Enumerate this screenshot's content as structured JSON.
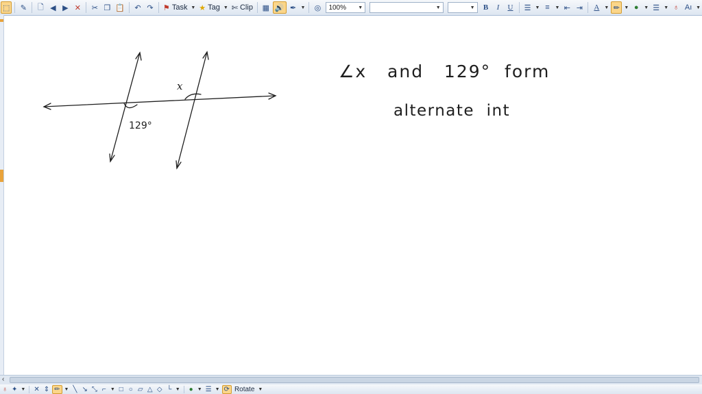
{
  "toolbar": {
    "task_label": "Task",
    "tag_label": "Tag",
    "clip_label": "Clip",
    "zoom_value": "100%",
    "font_name_value": "",
    "font_size_value": "",
    "bold_label": "B",
    "italic_label": "I",
    "underline_label": "U",
    "text_color_label": "A",
    "style_label": "Aı"
  },
  "drawing_toolbar": {
    "rotate_label": "Rotate"
  },
  "ink": {
    "diagram_angle_x": "x",
    "diagram_angle_129": "129°",
    "line1": "∠x   and   129°  form",
    "line2": "alternate  int"
  },
  "colors": {
    "ink": "#1e1e1e",
    "accent_orange": "#e9a33b",
    "toolbar_top": "#f6f8fb",
    "toolbar_bottom": "#dde6f1"
  }
}
